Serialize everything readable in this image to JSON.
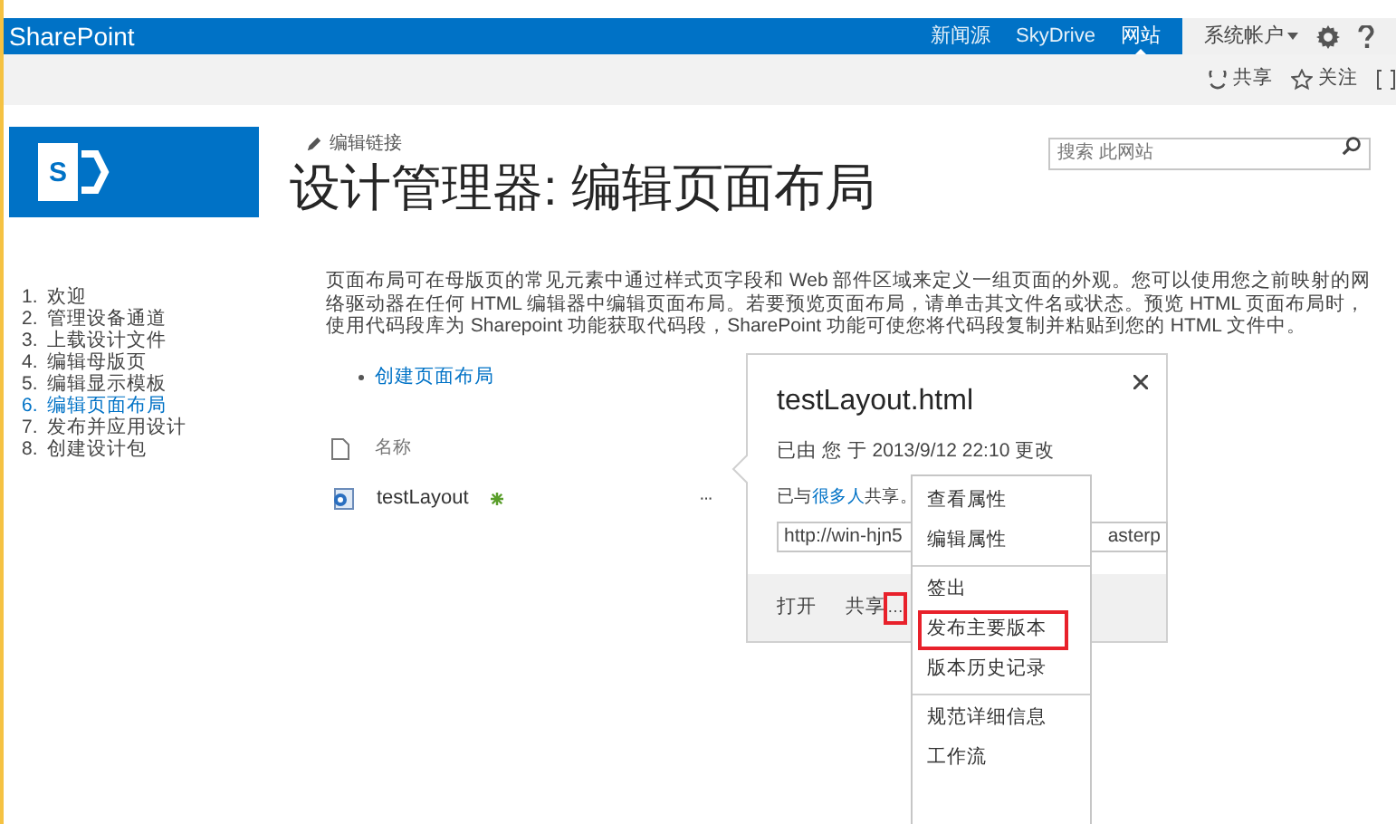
{
  "suite_bar": {
    "brand": "SharePoint",
    "links": [
      {
        "label": "新闻源",
        "selected": false
      },
      {
        "label": "SkyDrive",
        "selected": false
      },
      {
        "label": "网站",
        "selected": true
      }
    ],
    "account": "系统帐户"
  },
  "ribbon": {
    "actions": [
      "共享",
      "关注"
    ]
  },
  "header": {
    "logo_letter": "S",
    "edit_link": "编辑链接",
    "title": "设计管理器: 编辑页面布局",
    "search": {
      "placeholder": "搜索 此网站"
    }
  },
  "steps": [
    {
      "number": "1.",
      "label": "欢迎",
      "selected": false
    },
    {
      "number": "2.",
      "label": "管理设备通道",
      "selected": false
    },
    {
      "number": "3.",
      "label": "上载设计文件",
      "selected": false
    },
    {
      "number": "4.",
      "label": "编辑母版页",
      "selected": false
    },
    {
      "number": "5.",
      "label": "编辑显示模板",
      "selected": false
    },
    {
      "number": "6.",
      "label": "编辑页面布局",
      "selected": true
    },
    {
      "number": "7.",
      "label": "发布并应用设计",
      "selected": false
    },
    {
      "number": "8.",
      "label": "创建设计包",
      "selected": false
    }
  ],
  "description_lines": [
    "页面布局可在母版页的常见元素中通过样式页字段和 Web 部件区域来定义一组页面的外观。您可以使用您之前映射的网",
    "络驱动器在任何 HTML 编辑器中编辑页面布局。若要预览页面布局，请单击其文件名或状态。预览 HTML 页面布局时，",
    "使用代码段库为 Sharepoint 功能获取代码段，SharePoint 功能可使您将代码段复制并粘贴到您的 HTML 文件中。"
  ],
  "create_link": "创建页面布局",
  "file_list": {
    "column": "名称",
    "rows": [
      {
        "name": "testLayout",
        "is_new": true,
        "more": "···"
      }
    ]
  },
  "callout": {
    "title": "testLayout.html",
    "modified": "已由 您 于 2013/9/12 22:10 更改",
    "shared_prefix": "已与",
    "shared_link": "很多人",
    "shared_suffix": "共享。",
    "url_start": "http://win-hjn5",
    "url_end": "asterp",
    "actions": [
      "打开",
      "共享"
    ],
    "more": "…",
    "more_highlighted": true
  },
  "menu": [
    {
      "label": "查看属性",
      "divider_after": false,
      "highlighted": false
    },
    {
      "label": "编辑属性",
      "divider_after": true,
      "highlighted": false
    },
    {
      "label": "签出",
      "divider_after": false,
      "highlighted": false
    },
    {
      "label": "发布主要版本",
      "divider_after": false,
      "highlighted": true
    },
    {
      "label": "版本历史记录",
      "divider_after": true,
      "highlighted": false
    },
    {
      "label": "规范详细信息",
      "divider_after": false,
      "highlighted": false
    },
    {
      "label": "工作流",
      "divider_after": false,
      "highlighted": false
    }
  ]
}
